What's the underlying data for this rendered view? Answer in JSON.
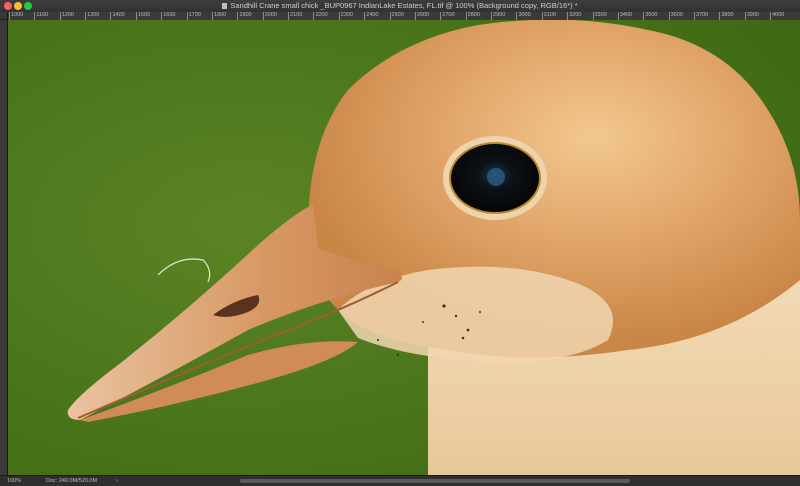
{
  "window": {
    "title": "Sandhill Crane small chick _BUP0967 IndianLake Estates, FL.tif @ 100% (Background copy, RGB/16*) *"
  },
  "ruler": {
    "ticks": [
      "1000",
      "1100",
      "1200",
      "1300",
      "1400",
      "1500",
      "1600",
      "1700",
      "1800",
      "1900",
      "2000",
      "2100",
      "2200",
      "2300",
      "2400",
      "2500",
      "2600",
      "2700",
      "2800",
      "2900",
      "3000",
      "3100",
      "3200",
      "3300",
      "3400",
      "3500",
      "3600",
      "3700",
      "3800",
      "3900",
      "4000"
    ]
  },
  "status": {
    "zoom": "100%",
    "doc_size": "Doc: 240.0M/520.0M",
    "arrow": "›"
  },
  "image": {
    "subject": "sandhill-crane-chick",
    "colors": {
      "background": "#4f7a1c",
      "down": "#e4b47a",
      "down_light": "#f0d9b8",
      "beak": "#d9a070",
      "eye": "#111111"
    }
  }
}
